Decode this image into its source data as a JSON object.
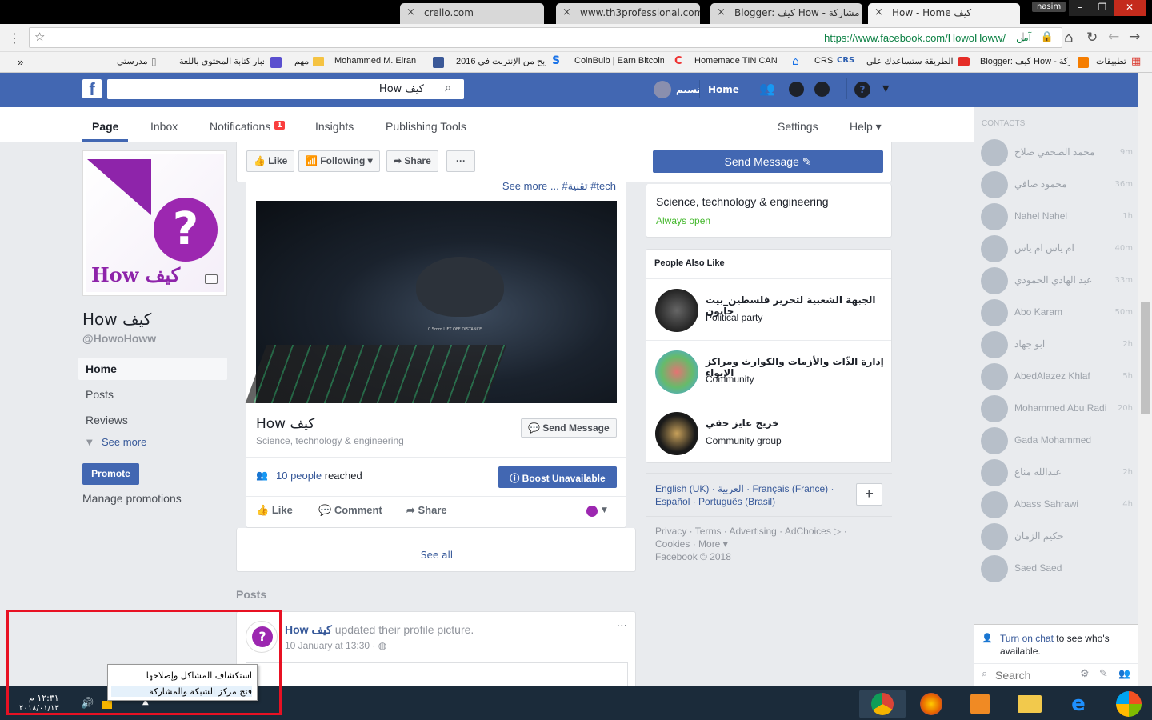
{
  "browser": {
    "tabs": [
      {
        "label": "crello.com"
      },
      {
        "label": "www.th3professional.com"
      },
      {
        "label": "Blogger: كيف How - مشاركة"
      },
      {
        "label": "How - Home كيف"
      }
    ],
    "user_badge": "nasim",
    "url": "https://www.facebook.com/HowoHoww/",
    "secure_label": "آمن",
    "bookmarks": [
      "تطبيقات",
      "Blogger: كيف How - مشاركة",
      "هذه الطريقة ستساعدك على",
      "CRS",
      "Homemade TIN CAN",
      "CoinBulb | Earn Bitcoin",
      "إربح من الإنترنت في 2016",
      "Mohammed M. Elran",
      "مهم",
      "اخبار كتابة المحتوى باللغة",
      "مدرستي",
      "»"
    ]
  },
  "fb": {
    "search_value": "How كيف",
    "profile_name": "نسيم",
    "home_label": "Home"
  },
  "page_tabs": {
    "page": "Page",
    "inbox": "Inbox",
    "notifications": "Notifications",
    "notif_count": "1",
    "insights": "Insights",
    "publishing": "Publishing Tools",
    "settings": "Settings",
    "help": "Help ▾"
  },
  "left": {
    "cover_text": "How كيف",
    "page_name": "How كيف",
    "handle": "@HowoHoww",
    "nav": [
      "Home",
      "Posts",
      "Reviews",
      "See more"
    ],
    "promote": "Promote",
    "manage": "Manage promotions"
  },
  "actions": {
    "like": "Like",
    "following": "Following",
    "share": "Share",
    "more": "···",
    "send_message": "Send Message"
  },
  "post": {
    "see_more": "See more ... #تقنية #tech",
    "title": "How كيف",
    "subtitle": "Science, technology & engineering",
    "send_message": "Send Message",
    "reached_count": "10 people",
    "reached_suffix": "reached",
    "boost": "Boost Unavailable",
    "like": "Like",
    "comment": "Comment",
    "share": "Share",
    "see_all": "See all",
    "mouse_text": "0.5mm LIFT OFF DISTANCE"
  },
  "posts_section": {
    "heading": "Posts",
    "author": "How كيف",
    "action": "updated their profile picture.",
    "date": "10 January at 13:30"
  },
  "about": {
    "category": "Science, technology & engineering",
    "open": "Always open"
  },
  "people_also_like": {
    "heading": "People Also Like",
    "items": [
      {
        "name": "الجبهة الشعبية لتحرير فلسطين_بيت حانون",
        "type": "Political party"
      },
      {
        "name": "إدارة الذّات والأزمات والكوارث ومراكز الإيواء",
        "type": "Community"
      },
      {
        "name": "خريج عايز حقي",
        "type": "Community group"
      }
    ]
  },
  "languages": {
    "line1": "English (UK) · العربية · Français (France) ·",
    "line2": "Español · Português (Brasil)"
  },
  "footer": {
    "line1": "Privacy · Terms · Advertising · AdChoices ▷ ·",
    "line2": "Cookies · More ▾",
    "line3": "Facebook © 2018"
  },
  "contacts": {
    "heading": "CONTACTS",
    "list": [
      {
        "name": "محمد الصحفي صلاح",
        "time": "9m"
      },
      {
        "name": "محمود صافي",
        "time": "36m"
      },
      {
        "name": "Nahel Nahel",
        "time": "1h"
      },
      {
        "name": "ام ياس ام ياس",
        "time": "40m"
      },
      {
        "name": "عبد الهادي الحمودي",
        "time": "33m"
      },
      {
        "name": "Abo Karam",
        "time": "50m"
      },
      {
        "name": "ابو جهاد",
        "time": "2h"
      },
      {
        "name": "AbedAlazez Khlaf",
        "time": "5h"
      },
      {
        "name": "Mohammed Abu Radi",
        "time": "20h"
      },
      {
        "name": "Gada Mohammed",
        "time": ""
      },
      {
        "name": "عبدالله مناع",
        "time": "2h"
      },
      {
        "name": "Abass Sahrawi",
        "time": "4h"
      },
      {
        "name": "حكيم الزمان",
        "time": ""
      },
      {
        "name": "Saed Saed",
        "time": ""
      }
    ],
    "turn_on_chat": "Turn on chat",
    "turn_on_suffix": "to see who's available.",
    "search_placeholder": "Search"
  },
  "taskbar": {
    "time": "١٢:٣١ م",
    "date": "٢٠١٨/٠١/١٣",
    "popup": [
      "استكشاف المشاكل وإصلاحها",
      "فتح مركز الشبكة والمشاركة"
    ]
  }
}
